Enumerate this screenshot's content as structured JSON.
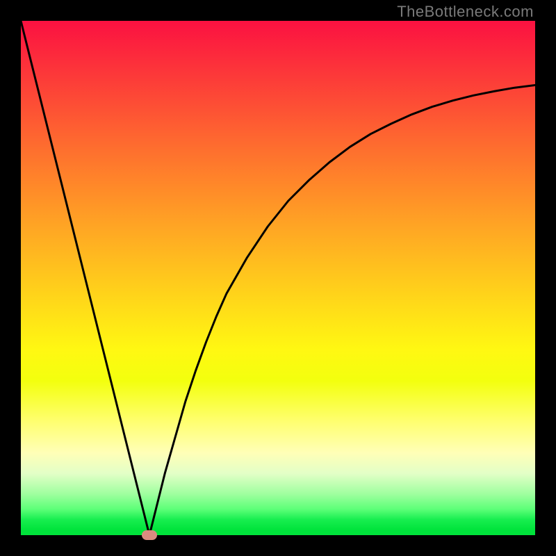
{
  "watermark": "TheBottleneck.com",
  "colors": {
    "frame": "#000000",
    "curve": "#000000",
    "marker": "#d98b80"
  },
  "chart_data": {
    "type": "line",
    "title": "",
    "xlabel": "",
    "ylabel": "",
    "xlim": [
      0,
      100
    ],
    "ylim": [
      0,
      100
    ],
    "x": [
      0,
      2,
      4,
      6,
      8,
      10,
      12,
      14,
      16,
      18,
      20,
      22,
      24,
      25,
      26,
      28,
      30,
      32,
      34,
      36,
      38,
      40,
      44,
      48,
      52,
      56,
      60,
      64,
      68,
      72,
      76,
      80,
      84,
      88,
      92,
      96,
      100
    ],
    "values": [
      100,
      92,
      84,
      76,
      68,
      60,
      52,
      44,
      36,
      28,
      20,
      12,
      4,
      0,
      4,
      12,
      19,
      26,
      32,
      37.5,
      42.5,
      47,
      54,
      60,
      65,
      69,
      72.5,
      75.5,
      78,
      80,
      81.8,
      83.3,
      84.5,
      85.5,
      86.3,
      87,
      87.5
    ],
    "annotations": [
      {
        "type": "marker",
        "x": 25,
        "y": 0,
        "shape": "pill"
      }
    ],
    "grid": false,
    "legend": false
  }
}
